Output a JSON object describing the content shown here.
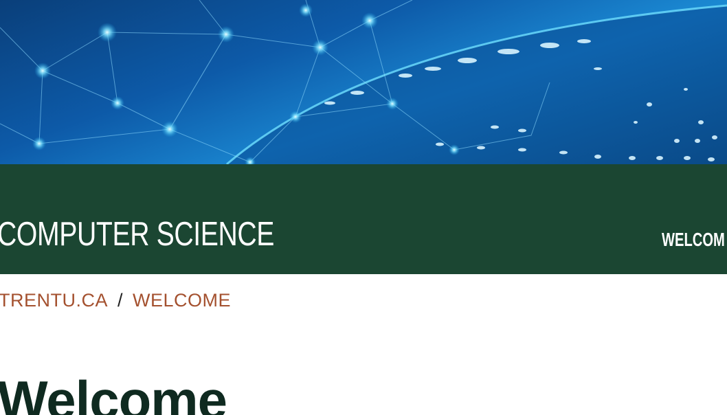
{
  "header": {
    "site_title": "COMPUTER SCIENCE",
    "nav_item": "WELCOM"
  },
  "breadcrumb": {
    "home": "TRENTU.CA",
    "separator": "/",
    "current": "WELCOME"
  },
  "main": {
    "heading": "Welcome"
  },
  "colors": {
    "title_bar": "#1b4632",
    "breadcrumb_link": "#a4512f",
    "heading": "#0f2a20"
  }
}
